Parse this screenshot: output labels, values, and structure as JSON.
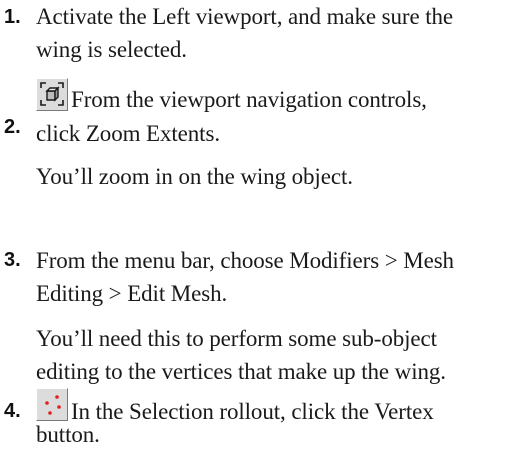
{
  "steps": [
    {
      "number": "1.",
      "lines": [
        "Activate the Left viewport, and make sure the",
        "wing is selected."
      ]
    },
    {
      "number": "2.",
      "icon": "zoom-extents-icon",
      "lines": [
        "From the viewport navigation controls,",
        "click Zoom Extents."
      ],
      "note": "You’ll zoom in on the wing object."
    },
    {
      "number": "3.",
      "lines": [
        "From the menu bar, choose Modifiers > Mesh",
        "Editing > Edit Mesh."
      ],
      "note_lines": [
        "You’ll need this to perform some sub-object",
        "editing to the vertices that make up the wing."
      ]
    },
    {
      "number": "4.",
      "icon": "vertex-icon",
      "lines": [
        "In the Selection rollout, click the Vertex",
        "button."
      ]
    }
  ],
  "colors": {
    "text": "#1a1a1a",
    "button_face": "#dcdcdc",
    "vertex_dot": "#e02020",
    "zoom_cube": "#1a1a1a"
  }
}
